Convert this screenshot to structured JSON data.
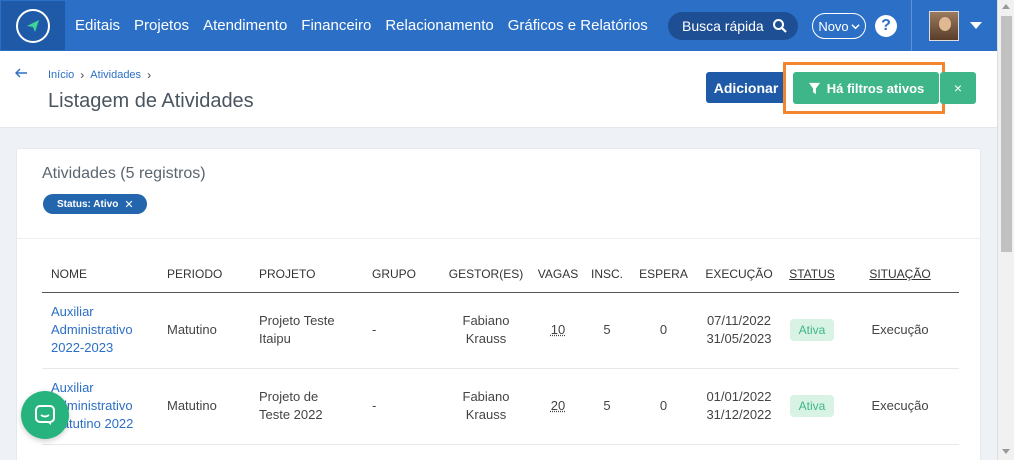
{
  "nav": {
    "items": [
      "Editais",
      "Projetos",
      "Atendimento",
      "Financeiro",
      "Relacionamento",
      "Gráficos e Relatórios"
    ],
    "search_label": "Busca rápida",
    "novo_label": "Novo",
    "help_label": "?"
  },
  "breadcrumb": [
    "Início",
    "Atividades"
  ],
  "page_title": "Listagem de Atividades",
  "buttons": {
    "add": "Adicionar",
    "filters_active": "Há filtros ativos",
    "clear": "×"
  },
  "card": {
    "title": "Atividades (5 registros)",
    "chip_label": "Status: Ativo",
    "chip_close": "✕"
  },
  "table": {
    "headers": [
      "NOME",
      "PERIODO",
      "PROJETO",
      "GRUPO",
      "GESTOR(ES)",
      "VAGAS",
      "INSC.",
      "ESPERA",
      "EXECUÇÃO",
      "STATUS",
      "SITUAÇÃO"
    ],
    "rows": [
      {
        "nome": [
          "Auxiliar",
          "Administrativo",
          "2022-2023"
        ],
        "periodo": "Matutino",
        "projeto": [
          "Projeto Teste",
          "Itaipu"
        ],
        "grupo": "-",
        "gestor": [
          "Fabiano",
          "Krauss"
        ],
        "vagas": "10",
        "insc": "5",
        "espera": "0",
        "execucao": [
          "07/11/2022",
          "31/05/2023"
        ],
        "status": "Ativa",
        "situacao": "Execução"
      },
      {
        "nome": [
          "Auxiliar",
          "Administrativo",
          "Matutino 2022"
        ],
        "periodo": "Matutino",
        "projeto": [
          "Projeto de",
          "Teste 2022"
        ],
        "grupo": "-",
        "gestor": [
          "Fabiano",
          "Krauss"
        ],
        "vagas": "20",
        "insc": "5",
        "espera": "0",
        "execucao": [
          "01/01/2022",
          "31/12/2022"
        ],
        "status": "Ativa",
        "situacao": "Execução"
      }
    ]
  },
  "colors": {
    "nav_bg": "#2c6fc6",
    "primary_btn": "#1f5aa8",
    "success": "#3fb68a",
    "highlight": "#f2852d"
  },
  "icons": [
    "logo-icon",
    "search-icon",
    "chevron-down-icon",
    "help-icon",
    "avatar",
    "caret-down-icon",
    "back-arrow-icon",
    "filter-icon",
    "close-icon",
    "chat-icon"
  ]
}
